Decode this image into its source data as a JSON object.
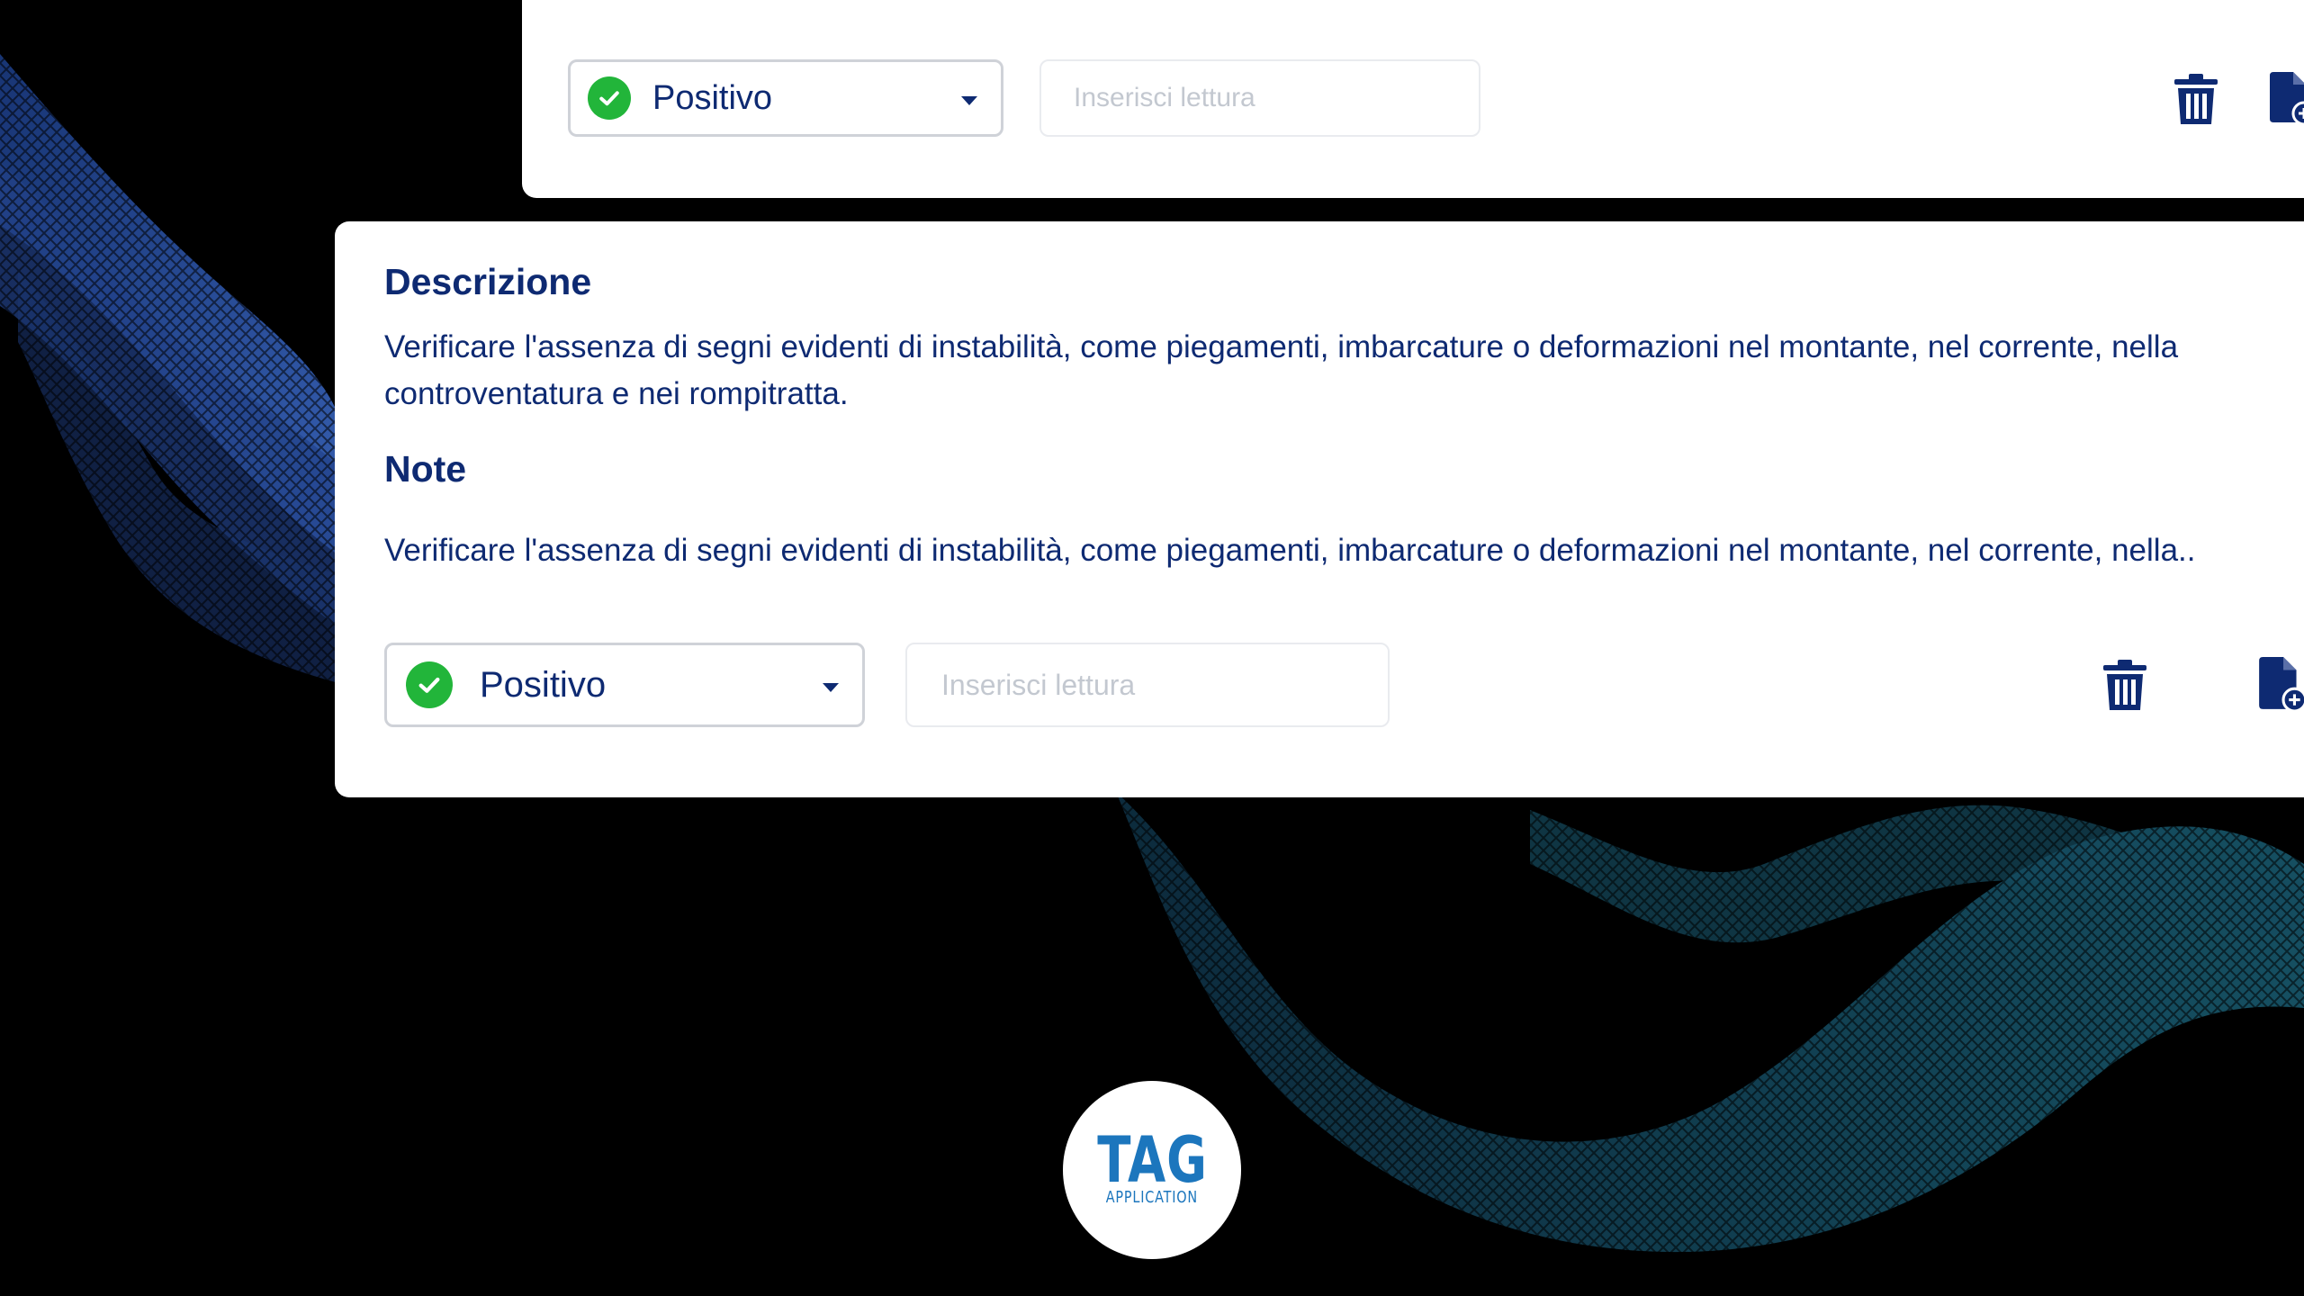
{
  "colors": {
    "brand_navy": "#0e2a72",
    "success_green": "#22b53a",
    "logo_blue": "#1c76bd",
    "background": "#000000"
  },
  "top_card": {
    "status_select": {
      "value": "Positivo",
      "icon": "check-circle-icon"
    },
    "reading_input": {
      "placeholder": "Inserisci lettura",
      "value": ""
    },
    "actions": [
      "trash-icon",
      "file-add-icon"
    ]
  },
  "main_card": {
    "description": {
      "heading": "Descrizione",
      "text": "Verificare l'assenza di segni evidenti di instabilità, come piegamenti, imbarcature o deformazioni nel montante, nel corrente, nella controventatura e nei rompitratta."
    },
    "note": {
      "heading": "Note",
      "text": "Verificare l'assenza di segni evidenti di instabilità, come piegamenti, imbarcature o deformazioni nel montante, nel corrente, nella.."
    },
    "status_select": {
      "value": "Positivo",
      "icon": "check-circle-icon"
    },
    "reading_input": {
      "placeholder": "Inserisci lettura",
      "value": ""
    },
    "actions": [
      "trash-icon",
      "file-add-icon"
    ]
  },
  "logo": {
    "main": "TAG",
    "sub": "APPLICATION"
  }
}
